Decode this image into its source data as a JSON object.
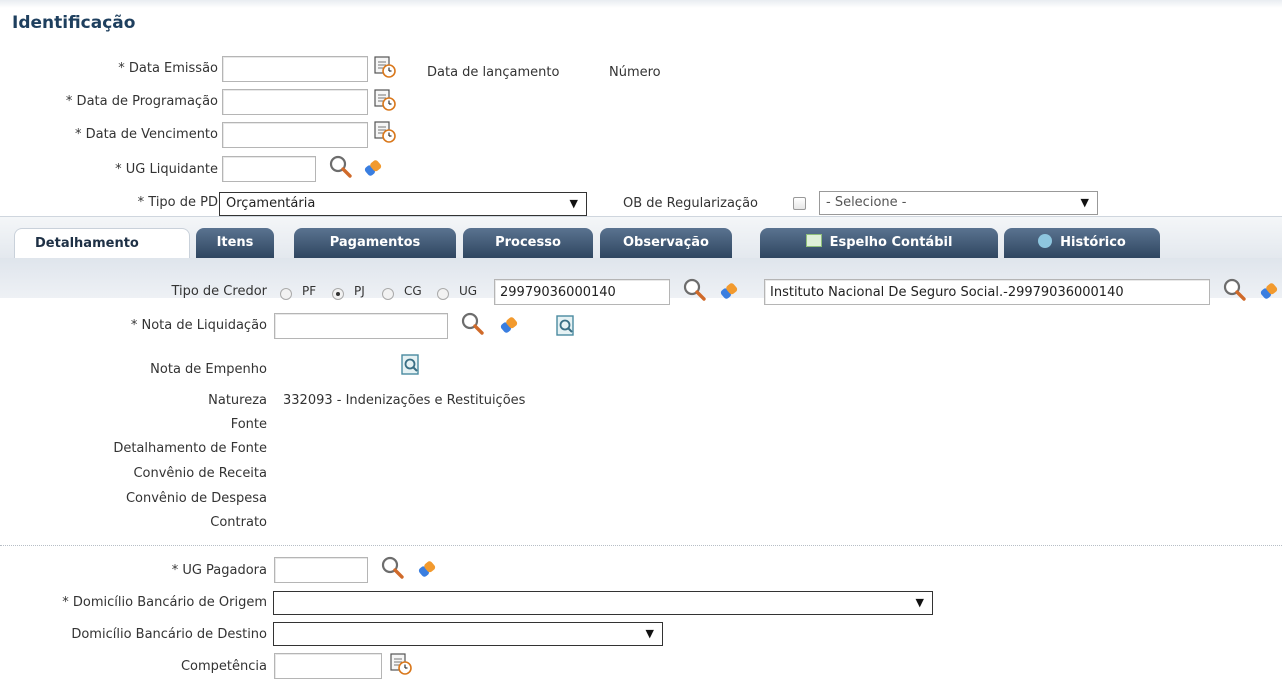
{
  "section_title": "Identificação",
  "header": {
    "data_emissao_label": "* Data Emissão",
    "data_programacao_label": "* Data de Programação",
    "data_vencimento_label": "* Data de Vencimento",
    "ug_liquidante_label": "* UG Liquidante",
    "tipo_pd_label": "* Tipo de PD",
    "tipo_pd_value": "Orçamentária",
    "data_lancamento_label": "Data de lançamento",
    "numero_label": "Número",
    "ob_regularizacao_label": "OB de Regularização",
    "ob_select_value": "- Selecione -"
  },
  "tabs": [
    {
      "label": "Detalhamento"
    },
    {
      "label": "Itens"
    },
    {
      "label": "Pagamentos"
    },
    {
      "label": "Processo"
    },
    {
      "label": "Observação"
    },
    {
      "label": "Espelho Contábil"
    },
    {
      "label": "Histórico"
    }
  ],
  "credor": {
    "label": "Tipo de Credor",
    "options": [
      "PF",
      "PJ",
      "CG",
      "UG"
    ],
    "selected": "PJ",
    "code_value": "29979036000140",
    "name_value": "Instituto Nacional De Seguro Social.-29979036000140"
  },
  "detalhe": {
    "nota_liquidacao_label": "* Nota de Liquidação",
    "nota_empenho_label": "Nota de Empenho",
    "natureza_label": "Natureza",
    "natureza_value": "332093 - Indenizações e Restituições",
    "fonte_label": "Fonte",
    "detalhamento_fonte_label": "Detalhamento de Fonte",
    "convenio_receita_label": "Convênio de Receita",
    "convenio_despesa_label": "Convênio de Despesa",
    "contrato_label": "Contrato"
  },
  "pagamento": {
    "ug_pagadora_label": "* UG Pagadora",
    "domicilio_origem_label": "* Domicílio Bancário de Origem",
    "domicilio_destino_label": "Domicílio Bancário de Destino",
    "competencia_label": "Competência"
  },
  "icons": {
    "calendar": "calendar-icon",
    "search": "magnifier-icon",
    "eraser": "eraser-icon",
    "detail": "document-search-icon",
    "table": "table-icon",
    "history": "history-icon"
  },
  "colors": {
    "title": "#1e3f5e",
    "tab_dark": "#2f4660",
    "eraser_blue": "#3a7ee0",
    "eraser_orange": "#f29a2e"
  }
}
